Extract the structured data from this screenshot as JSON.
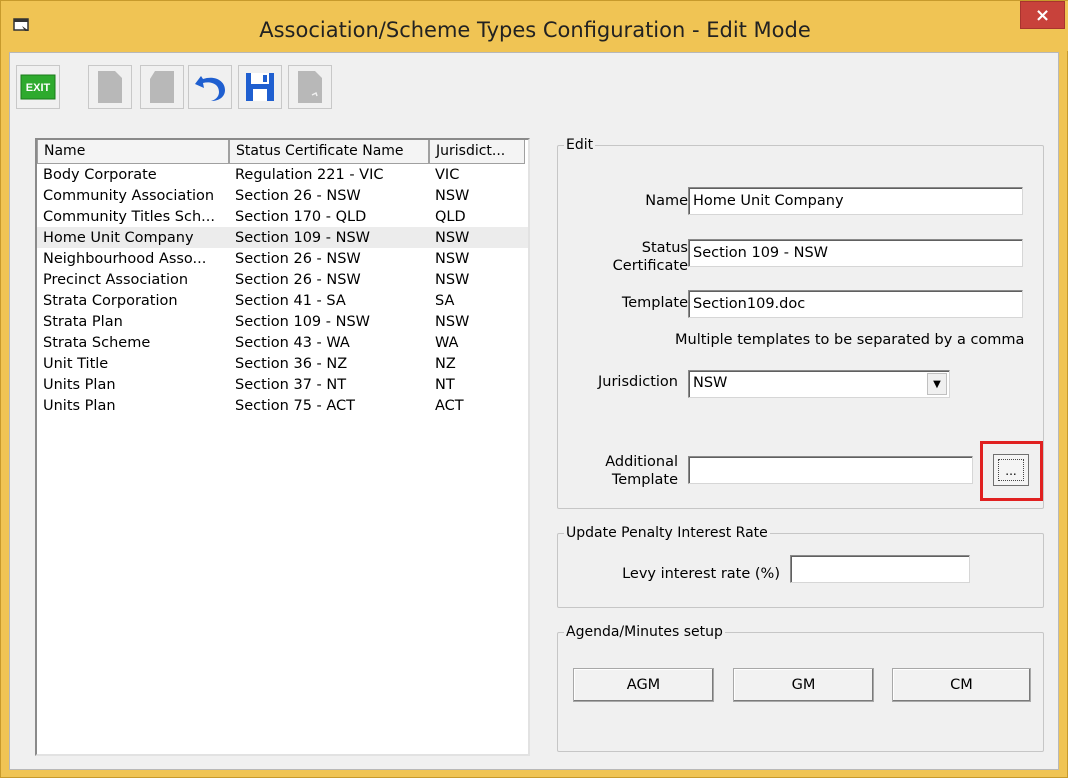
{
  "window": {
    "title": "Association/Scheme Types Configuration - Edit Mode",
    "close_glyph": "×"
  },
  "toolbar": {
    "buttons": [
      {
        "icon": "exit-icon",
        "label": "EXIT",
        "enabled": true
      },
      {
        "icon": "new-document-icon",
        "enabled": false
      },
      {
        "icon": "copy-document-icon",
        "enabled": false
      },
      {
        "icon": "undo-icon",
        "enabled": true
      },
      {
        "icon": "save-icon",
        "enabled": true
      },
      {
        "icon": "delete-document-icon",
        "enabled": false
      }
    ]
  },
  "list": {
    "columns": [
      "Name",
      "Status Certificate Name",
      "Jurisdict..."
    ],
    "selected_index": 3,
    "rows": [
      [
        "Body Corporate",
        "Regulation 221 - VIC",
        "VIC"
      ],
      [
        "Community Association",
        "Section 26 - NSW",
        "NSW"
      ],
      [
        "Community Titles Sch...",
        "Section 170 - QLD",
        "QLD"
      ],
      [
        "Home Unit Company",
        "Section 109 - NSW",
        "NSW"
      ],
      [
        "Neighbourhood Asso...",
        "Section 26 - NSW",
        "NSW"
      ],
      [
        "Precinct Association",
        "Section 26 - NSW",
        "NSW"
      ],
      [
        "Strata Corporation",
        "Section 41 - SA",
        "SA"
      ],
      [
        "Strata Plan",
        "Section 109 - NSW",
        "NSW"
      ],
      [
        "Strata Scheme",
        "Section 43 - WA",
        "WA"
      ],
      [
        "Unit Title",
        "Section 36 - NZ",
        "NZ"
      ],
      [
        "Units Plan",
        "Section 37 - NT",
        "NT"
      ],
      [
        "Units Plan",
        "Section 75 - ACT",
        "ACT"
      ]
    ]
  },
  "edit": {
    "legend": "Edit",
    "name_label": "Name",
    "name_value": "Home Unit Company",
    "status_label_1": "Status",
    "status_label_2": "Certificate",
    "status_value": "Section 109 - NSW",
    "template_label": "Template",
    "template_value": "Section109.doc",
    "template_hint": "Multiple templates to be separated by a comma",
    "jurisdiction_label": "Jurisdiction",
    "jurisdiction_value": "NSW",
    "additional_label_1": "Additional",
    "additional_label_2": "Template",
    "additional_value": "",
    "browse_label": "..."
  },
  "penalty": {
    "legend": "Update Penalty Interest Rate",
    "levy_label": "Levy interest rate (%)",
    "levy_value": ""
  },
  "agenda": {
    "legend": "Agenda/Minutes setup",
    "buttons": [
      "AGM",
      "GM",
      "CM"
    ]
  },
  "colors": {
    "title_bar": "#f0c454",
    "close": "#c8423b",
    "highlight_box": "#e02020",
    "icon_blue": "#1f5fd0",
    "icon_gray": "#b8b8b8",
    "exit_green": "#2eaa2e"
  }
}
